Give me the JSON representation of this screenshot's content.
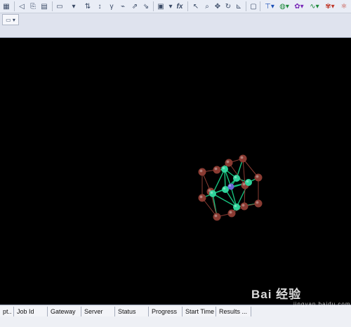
{
  "toolbar": {
    "buttons": [
      {
        "icon": "dock-panel-icon"
      },
      {
        "icon": "arrow-left-icon"
      },
      {
        "icon": "copy-icon"
      },
      {
        "icon": "table-icon"
      },
      {
        "icon": "sort-icon"
      },
      {
        "icon": "function-icon"
      },
      {
        "icon": "window-icon"
      },
      {
        "icon": "select-arrow-icon"
      },
      {
        "icon": "zoom-icon"
      },
      {
        "icon": "move-icon"
      },
      {
        "icon": "rotate-icon"
      },
      {
        "icon": "measure-icon"
      },
      {
        "icon": "bond-icon"
      },
      {
        "icon": "sphere-icon"
      },
      {
        "icon": "color-icon"
      },
      {
        "icon": "spectrum-icon"
      },
      {
        "icon": "molecule-icon"
      }
    ],
    "fx_label": "fx"
  },
  "jobs_panel": {
    "columns": [
      "pt..",
      "Job Id",
      "Gateway",
      "Server",
      "Status",
      "Progress",
      "Start Time",
      "Results ..."
    ]
  },
  "watermark": {
    "text": "Bai 经验",
    "sub": "jingyan.baidu.com"
  },
  "viewer": {
    "atom_colors": {
      "green": "#2fd29a",
      "brown": "#8a3b32",
      "purple": "#6b66d8"
    },
    "bond_color": "#17c27e"
  }
}
